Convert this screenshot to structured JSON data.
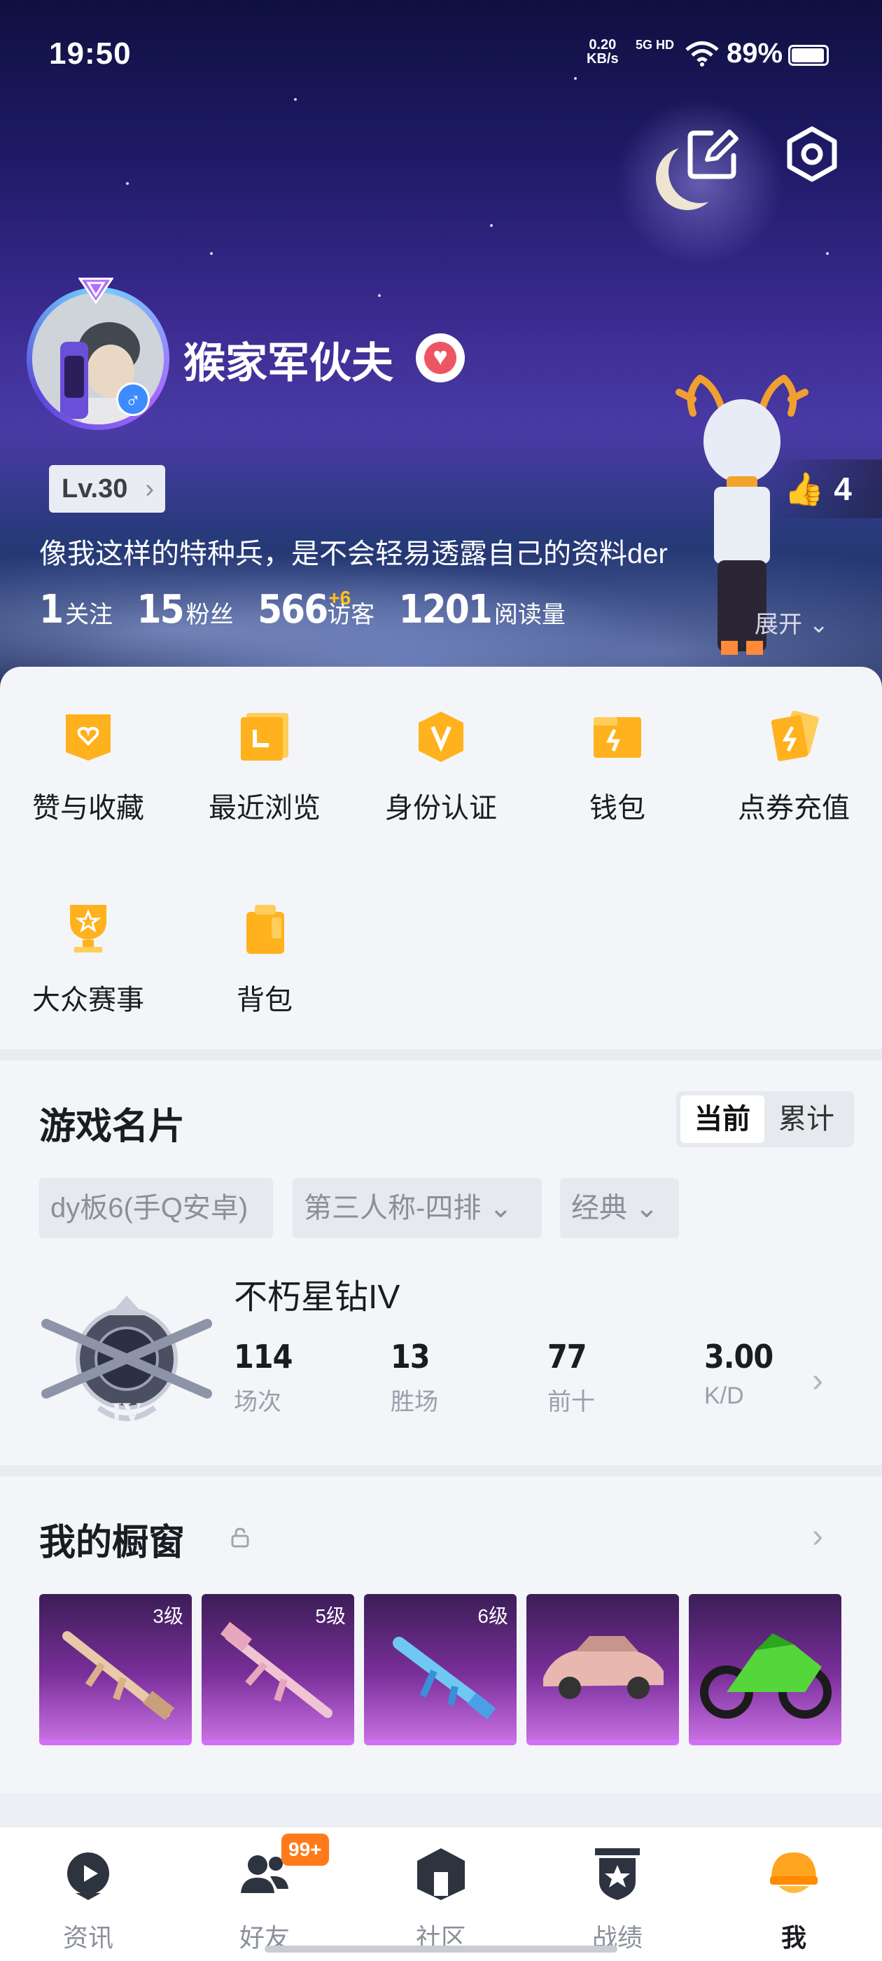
{
  "status_bar": {
    "time": "19:50",
    "net_speed_value": "0.20",
    "net_speed_unit": "KB/s",
    "network": "5G HD",
    "battery": "89%"
  },
  "profile": {
    "nickname": "猴家军伙夫",
    "level": "Lv.30",
    "likes": "4",
    "bio": "像我这样的特种兵，是不会轻易透露自己的资料der",
    "stats": [
      {
        "value": "1",
        "label": "关注"
      },
      {
        "value": "15",
        "label": "粉丝"
      },
      {
        "value": "566",
        "label": "访客",
        "delta": "+6"
      },
      {
        "value": "1201",
        "label": "阅读量"
      }
    ],
    "expand_label": "展开"
  },
  "quick_menu": [
    {
      "label": "赞与收藏",
      "icon": "heart-box-icon"
    },
    {
      "label": "最近浏览",
      "icon": "history-icon"
    },
    {
      "label": "身份认证",
      "icon": "verify-icon"
    },
    {
      "label": "钱包",
      "icon": "wallet-icon"
    },
    {
      "label": "点券充值",
      "icon": "coupon-icon"
    },
    {
      "label": "大众赛事",
      "icon": "trophy-icon"
    },
    {
      "label": "背包",
      "icon": "backpack-icon"
    }
  ],
  "game_card": {
    "title": "游戏名片",
    "toggle": {
      "current": "当前",
      "total": "累计"
    },
    "filters": {
      "server": "dy板6(手Q安卓)",
      "mode": "第三人称-四排",
      "map": "经典"
    },
    "tier": "不朽星钻IV",
    "stats": [
      {
        "value": "114",
        "label": "场次"
      },
      {
        "value": "13",
        "label": "胜场"
      },
      {
        "value": "77",
        "label": "前十"
      },
      {
        "value": "3.00",
        "label": "K/D"
      }
    ]
  },
  "showcase": {
    "title": "我的橱窗",
    "items": [
      {
        "level": "3级",
        "kind": "rifle"
      },
      {
        "level": "5级",
        "kind": "rifle"
      },
      {
        "level": "6级",
        "kind": "smg"
      },
      {
        "level": "",
        "kind": "car"
      },
      {
        "level": "",
        "kind": "motorbike"
      }
    ]
  },
  "bottom_nav": {
    "items": [
      {
        "label": "资讯"
      },
      {
        "label": "好友"
      },
      {
        "label": "社区"
      },
      {
        "label": "战绩"
      },
      {
        "label": "我"
      }
    ],
    "friends_badge": "99+"
  },
  "colors": {
    "accent_orange": "#ffb21e",
    "badge_orange": "#ff7a1a",
    "heart_red": "#ee5563",
    "showcase_purple": "#7a2f9a"
  }
}
